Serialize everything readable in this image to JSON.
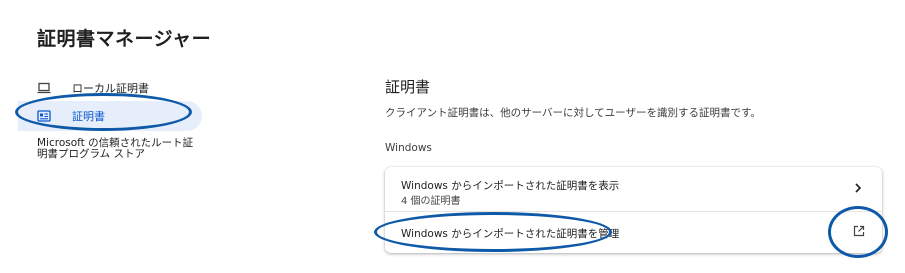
{
  "page": {
    "title": "証明書マネージャー"
  },
  "sidebar": {
    "items": [
      {
        "label": "ローカル証明書",
        "icon": "laptop-icon"
      },
      {
        "label": "証明書",
        "icon": "certificate-card-icon",
        "selected": true
      },
      {
        "label_line1": "Microsoft の信頼されたルート証",
        "label_line2": "明書プログラム ストア"
      }
    ]
  },
  "main": {
    "title": "証明書",
    "description": "クライアント証明書は、他のサーバーに対してユーザーを識別する証明書です。",
    "group_label": "Windows",
    "rows": [
      {
        "title": "Windows からインポートされた証明書を表示",
        "subtitle": "4 個の証明書",
        "icon": "chevron-right-icon"
      },
      {
        "title": "Windows からインポートされた証明書を管理",
        "icon": "open-in-new-icon"
      }
    ]
  },
  "colors": {
    "accent": "#0b57d0",
    "selected_bg": "#e6eefb",
    "annotation_ring": "#0e5aa8"
  }
}
